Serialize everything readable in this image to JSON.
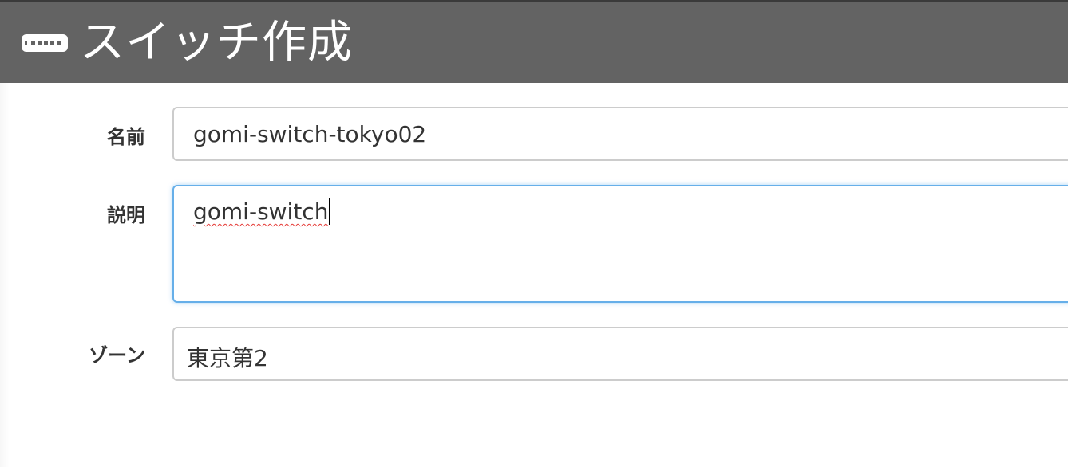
{
  "header": {
    "icon": "switch-icon",
    "title": "スイッチ作成",
    "background": "#636363"
  },
  "form": {
    "name": {
      "label": "名前",
      "value": "gomi-switch-tokyo02"
    },
    "description": {
      "label": "説明",
      "value": "gomi-switch"
    },
    "zone": {
      "label": "ゾーン",
      "value": "東京第2"
    }
  },
  "colors": {
    "focus_border": "#66afe9",
    "field_border": "#cccccc",
    "label_text": "#333333"
  }
}
